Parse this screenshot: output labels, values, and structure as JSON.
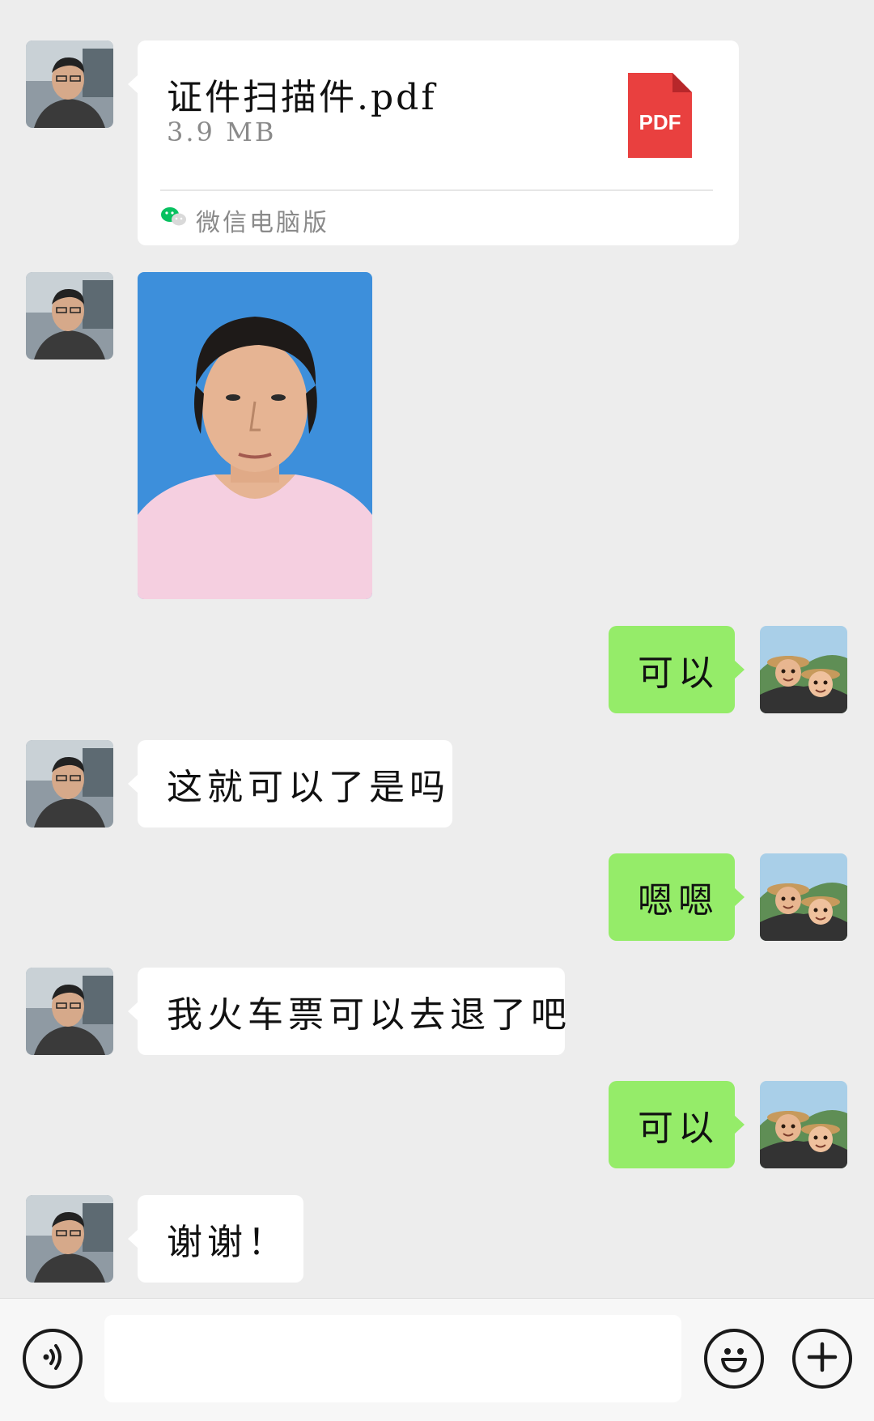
{
  "messages": [
    {
      "type": "file",
      "side": "left",
      "file_name": "证件扫描件.pdf",
      "file_size": "3.9 MB",
      "file_badge": "PDF",
      "source": "微信电脑版"
    },
    {
      "type": "image",
      "side": "left",
      "image": "id-photo-woman-pink-shirt-blue-background"
    },
    {
      "type": "text",
      "side": "right",
      "text": "可以"
    },
    {
      "type": "text",
      "side": "left",
      "text": "这就可以了是吗"
    },
    {
      "type": "text",
      "side": "right",
      "text": "嗯嗯"
    },
    {
      "type": "text",
      "side": "left",
      "text": "我火车票可以去退了吧"
    },
    {
      "type": "text",
      "side": "right",
      "text": "可以"
    },
    {
      "type": "text",
      "side": "left",
      "text": "谢谢！"
    }
  ],
  "input_bar": {
    "voice_icon": "voice-icon",
    "message_value": "",
    "emoji_icon": "emoji-icon",
    "plus_icon": "plus-icon"
  },
  "colors": {
    "background": "#ededed",
    "own_bubble": "#95ec69",
    "other_bubble": "#ffffff",
    "pdf_red": "#e9403f",
    "wechat_green": "#07c160"
  }
}
